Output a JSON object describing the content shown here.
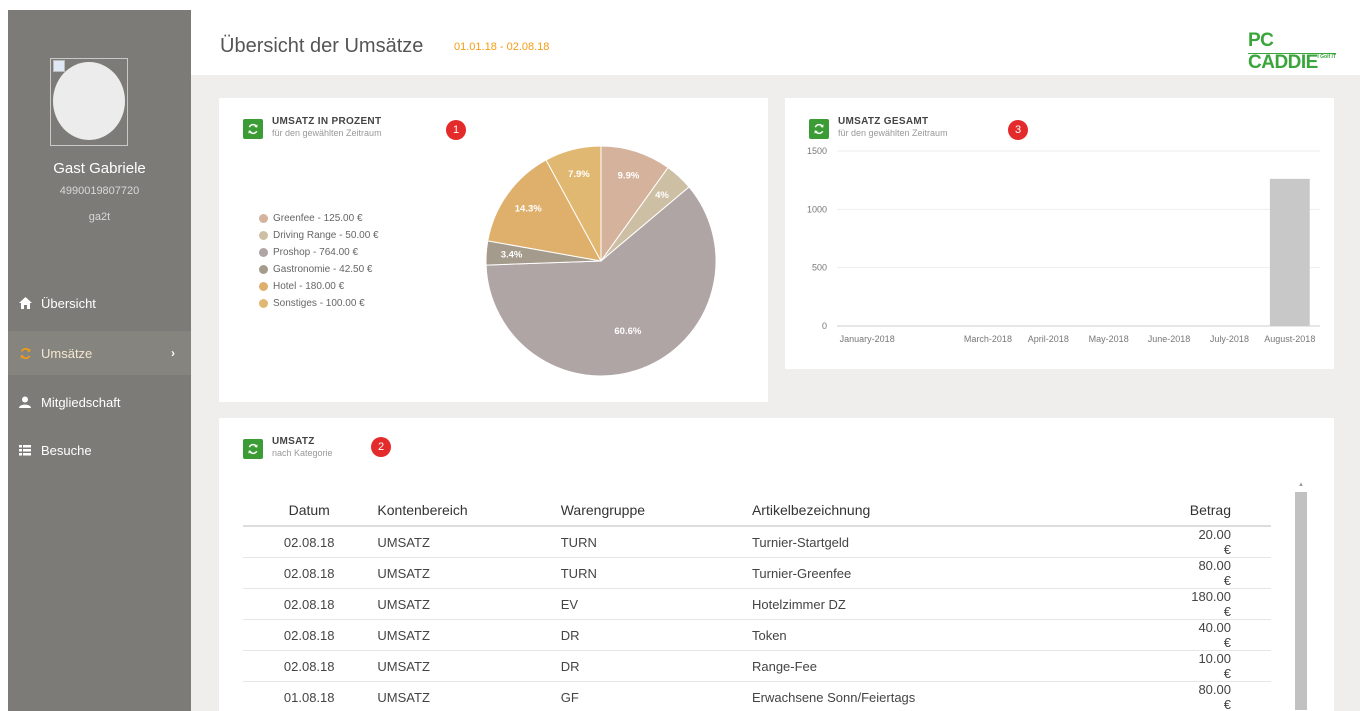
{
  "user": {
    "name": "Gast Gabriele",
    "id": "4990019807720",
    "login": "ga2t"
  },
  "nav": {
    "items": [
      {
        "label": "Übersicht",
        "icon": "home-icon"
      },
      {
        "label": "Umsätze",
        "icon": "refresh-icon",
        "active": true
      },
      {
        "label": "Mitgliedschaft",
        "icon": "user-icon"
      },
      {
        "label": "Besuche",
        "icon": "list-icon"
      }
    ]
  },
  "header": {
    "title": "Übersicht der Umsätze",
    "date_range": "01.01.18 - 02.08.18",
    "logo": "PC CADDIE",
    "logo_sub": "I Golf IT"
  },
  "colors": {
    "accent_green": "#3b9b35",
    "date_orange": "#f39c12",
    "badge_red": "#e32b2b",
    "sidebar": "#7c7b77"
  },
  "pie_panel": {
    "title": "UMSATZ IN PROZENT",
    "subtitle": "für den gewählten Zeitraum",
    "badge": "1"
  },
  "bar_panel": {
    "title": "UMSATZ GESAMT",
    "subtitle": "für den gewählten Zeitraum",
    "badge": "3"
  },
  "table_panel": {
    "title": "UMSATZ",
    "subtitle": "nach Kategorie",
    "badge": "2",
    "columns": [
      "Datum",
      "Kontenbereich",
      "Warengruppe",
      "Artikelbezeichnung",
      "Betrag"
    ],
    "rows": [
      [
        "02.08.18",
        "UMSATZ",
        "TURN",
        "Turnier-Startgeld",
        "20.00 €"
      ],
      [
        "02.08.18",
        "UMSATZ",
        "TURN",
        "Turnier-Greenfee",
        "80.00 €"
      ],
      [
        "02.08.18",
        "UMSATZ",
        "EV",
        "Hotelzimmer DZ",
        "180.00 €"
      ],
      [
        "02.08.18",
        "UMSATZ",
        "DR",
        "Token",
        "40.00 €"
      ],
      [
        "02.08.18",
        "UMSATZ",
        "DR",
        "Range-Fee",
        "10.00 €"
      ],
      [
        "01.08.18",
        "UMSATZ",
        "GF",
        "Erwachsene Sonn/Feiertags",
        "80.00 €"
      ]
    ]
  },
  "chart_data": [
    {
      "type": "pie",
      "labels": [
        "Greenfee - 125.00 €",
        "Driving Range - 50.00 €",
        "Proshop - 764.00 €",
        "Gastronomie - 42.50 €",
        "Hotel - 180.00 €",
        "Sonstiges - 100.00 €"
      ],
      "values": [
        125.0,
        50.0,
        764.0,
        42.5,
        180.0,
        100.0
      ],
      "percent_labels": [
        "9.9%",
        "4%",
        "60.6%",
        "3.4%",
        "14.3%",
        "7.9%"
      ],
      "colors": [
        "#d4b29c",
        "#cdbfa3",
        "#b0a5a5",
        "#a49b8d",
        "#dfb06c",
        "#e1b871"
      ],
      "legend": "left"
    },
    {
      "type": "bar",
      "categories": [
        "January-2018",
        "",
        "March-2018",
        "April-2018",
        "May-2018",
        "June-2018",
        "July-2018",
        "August-2018"
      ],
      "values": [
        0,
        0,
        0,
        0,
        0,
        0,
        0,
        1261.5
      ],
      "ylim": [
        0,
        1500
      ],
      "yticks": [
        0,
        500,
        1000,
        1500
      ],
      "grid": true,
      "bar_color": "#c8c8c8"
    }
  ]
}
